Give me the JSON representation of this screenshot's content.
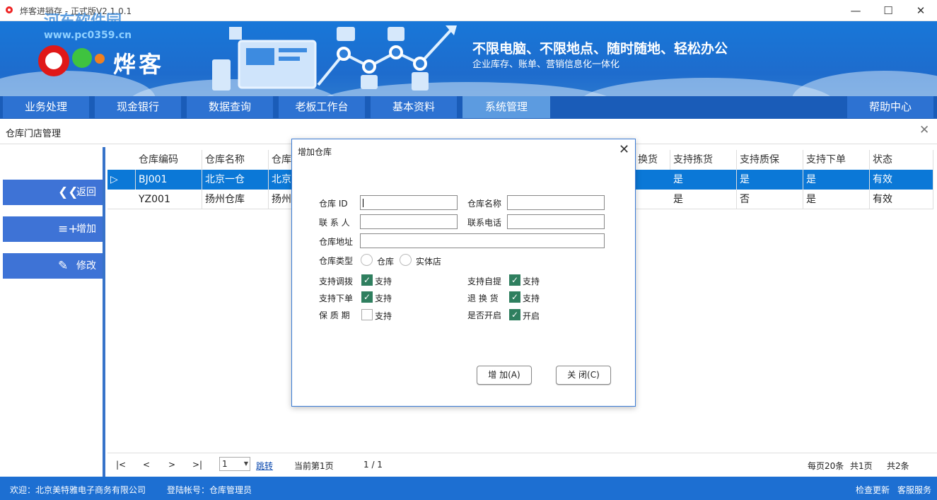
{
  "window": {
    "title": "烨客进销存 - 正式版V2.1.0.1",
    "watermark": "河东软件园",
    "watermark_url": "www.pc0359.cn"
  },
  "banner": {
    "brand": "烨客",
    "slogan": "不限电脑、不限地点、随时随地、轻松办公",
    "subtitle": "企业库存、账单、营销信息化一体化"
  },
  "nav": {
    "tabs": [
      "业务处理",
      "现金银行",
      "数据查询",
      "老板工作台",
      "基本资料",
      "系统管理"
    ],
    "active": "系统管理",
    "help": "帮助中心"
  },
  "page": {
    "title": "仓库门店管理"
  },
  "sidebar": {
    "back": "返回",
    "add": "增加",
    "edit": "修改"
  },
  "grid": {
    "columns": [
      "仓库编码",
      "仓库名称",
      "仓库",
      "换货",
      "支持拣货",
      "支持质保",
      "支持下单",
      "状态"
    ],
    "rows": [
      {
        "code": "BJ001",
        "name": "北京一仓",
        "addr": "北京",
        "c4": "是",
        "c5": "是",
        "c6": "是",
        "status": "有效",
        "selected": true
      },
      {
        "code": "YZ001",
        "name": "扬州仓库",
        "addr": "扬州",
        "c4": "是",
        "c5": "否",
        "c6": "是",
        "status": "有效",
        "selected": false
      }
    ]
  },
  "pager": {
    "first": "|<",
    "prev": "<",
    "next": ">",
    "last": ">|",
    "page_value": "1",
    "jump": "跳转",
    "current": "当前第1页",
    "ratio": "1 / 1",
    "per_page": "每页20条",
    "pages": "共1页",
    "total": "共2条"
  },
  "status": {
    "welcome": "欢迎：北京美特雅电子商务有限公司",
    "account": "登陆帐号：仓库管理员",
    "update": "检查更新",
    "service": "客服服务"
  },
  "dialog": {
    "title": "增加仓库",
    "labels": {
      "id": "仓库 ID",
      "name": "仓库名称",
      "contact": "联 系 人",
      "phone": "联系电话",
      "address": "仓库地址",
      "type": "仓库类型"
    },
    "type_options": [
      "仓库",
      "实体店"
    ],
    "checks": [
      {
        "label": "支持调拨",
        "text": "支持",
        "checked": true
      },
      {
        "label": "支持自提",
        "text": "支持",
        "checked": true
      },
      {
        "label": "支持下单",
        "text": "支持",
        "checked": true
      },
      {
        "label": "退 换 货",
        "text": "支持",
        "checked": true
      },
      {
        "label": "保 质 期",
        "text": "支持",
        "checked": false
      },
      {
        "label": "是否开启",
        "text": "开启",
        "checked": true
      }
    ],
    "add_button": "增 加(A)",
    "close_button": "关 闭(C)"
  }
}
